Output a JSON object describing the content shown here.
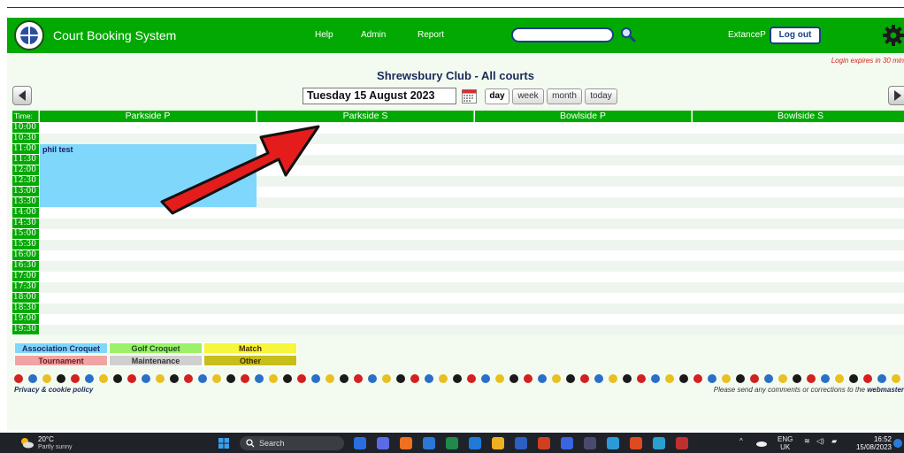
{
  "header": {
    "app_title": "Court Booking System",
    "nav": [
      "Help",
      "Admin",
      "Report"
    ],
    "search_value": "",
    "user": "ExtanceP",
    "logout_label": "Log out"
  },
  "login_expires": "Login expires in 30 min",
  "club_title": "Shrewsbury Club - All courts",
  "date": "Tuesday 15 August 2023",
  "views": [
    "day",
    "week",
    "month",
    "today"
  ],
  "grid": {
    "time_header": "Time:",
    "courts": [
      "Parkside P",
      "Parkside S",
      "Bowlside P",
      "Bowlside S"
    ],
    "times": [
      "10:00",
      "10:30",
      "11:00",
      "11:30",
      "12:00",
      "12:30",
      "13:00",
      "13:30",
      "14:00",
      "14:30",
      "15:00",
      "15:30",
      "16:00",
      "16:30",
      "17:00",
      "17:30",
      "18:00",
      "18:30",
      "19:00",
      "19:30"
    ],
    "booking": {
      "label": "phil test",
      "court": "Parkside P",
      "start": "11:00",
      "end": "14:00"
    }
  },
  "legend": [
    {
      "label": "Association Croquet",
      "color": "#7fd7fb"
    },
    {
      "label": "Golf Croquet",
      "color": "#9cf06a"
    },
    {
      "label": "Match",
      "color": "#f6f63a"
    },
    {
      "label": "Tournament",
      "color": "#f2a3a3"
    },
    {
      "label": "Maintenance",
      "color": "#cfcfcf"
    },
    {
      "label": "Other",
      "color": "#c8be1a"
    }
  ],
  "dot_colors": [
    "#d42020",
    "#2a6fc8",
    "#e8c020",
    "#1a1a1a"
  ],
  "footer": {
    "privacy": "Privacy & cookie policy",
    "comments": "Please send any comments or corrections to the",
    "webmaster": "webmaster"
  },
  "taskbar": {
    "temp": "20°C",
    "condition": "Partly sunny",
    "search": "Search",
    "lang": "ENG",
    "region": "UK",
    "time": "16:52",
    "date": "15/08/2023"
  }
}
